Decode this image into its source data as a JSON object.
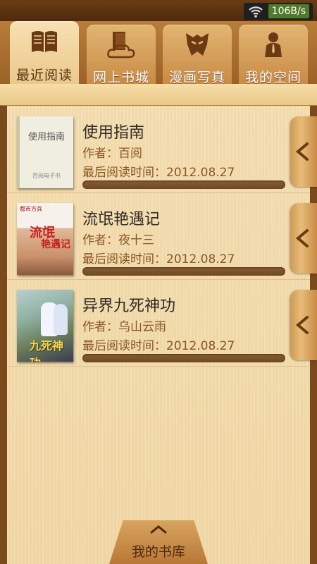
{
  "status_bar": {
    "net_speed": "106B/s",
    "wifi_icon": "wifi-icon"
  },
  "tabs": [
    {
      "label": "最近阅读",
      "icon": "open-book-icon",
      "active": true
    },
    {
      "label": "网上书城",
      "icon": "cloud-book-icon",
      "active": false
    },
    {
      "label": "漫画写真",
      "icon": "robot-mask-icon",
      "active": false
    },
    {
      "label": "我的空间",
      "icon": "person-icon",
      "active": false
    }
  ],
  "books": [
    {
      "title": "使用指南",
      "author": "作者：百阅",
      "last_read": "最后阅读时间：2012.08.27",
      "progress": 0.0,
      "cover_title": "使用指南",
      "cover_sub": "百阅电子书"
    },
    {
      "title": "流氓艳遇记",
      "author": "作者：夜十三",
      "last_read": "最后阅读时间：2012.08.27",
      "progress": 0.0,
      "cover_title": "流氓",
      "cover_sub": "艳遇记",
      "cover_top": "都市方兵"
    },
    {
      "title": "异界九死神功",
      "author": "作者：乌山云雨",
      "last_read": "最后阅读时间：2012.08.27",
      "progress": 0.0,
      "cover_title": "九死神功"
    }
  ],
  "bottom_tab": {
    "label": "我的书库"
  },
  "colors": {
    "wood_dark": "#7a4a1c",
    "panel": "#f3dba9",
    "text_brown": "#8b5524",
    "active_tab": "#f0d49f"
  }
}
